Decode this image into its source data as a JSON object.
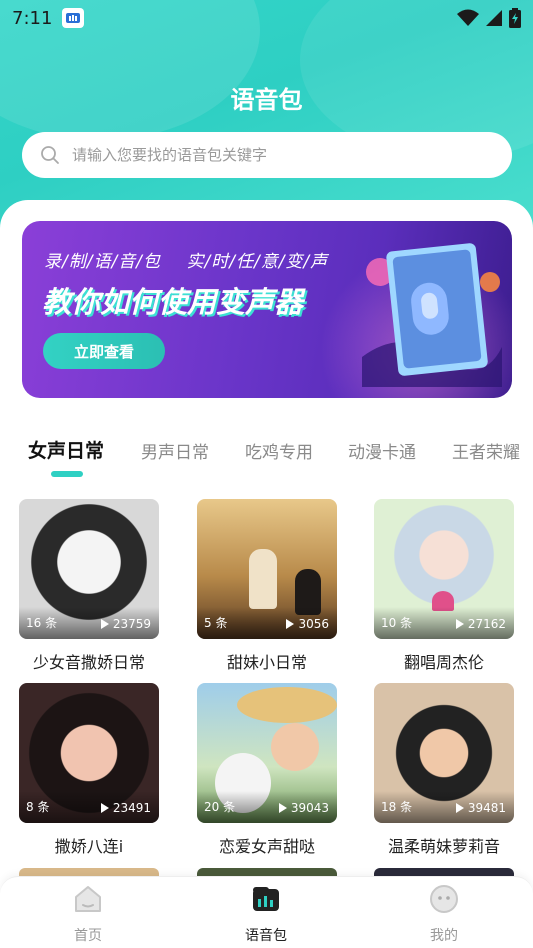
{
  "status_bar": {
    "time": "7:11"
  },
  "header": {
    "title": "语音包",
    "search_placeholder": "请输入您要找的语音包关键字"
  },
  "banner": {
    "subtitle": "录/制/语/音/包    实/时/任/意/变/声",
    "headline": "教你如何使用变声器",
    "button_label": "立即查看"
  },
  "tabs": [
    {
      "label": "女声日常",
      "active": true
    },
    {
      "label": "男声日常",
      "active": false
    },
    {
      "label": "吃鸡专用",
      "active": false
    },
    {
      "label": "动漫卡通",
      "active": false
    },
    {
      "label": "王者荣耀",
      "active": false
    }
  ],
  "cards": [
    {
      "name": "少女音撒娇日常",
      "count": "16 条",
      "plays": "23759",
      "palette": [
        "#e9e9e9",
        "#444444"
      ]
    },
    {
      "name": "甜妹小日常",
      "count": "5 条",
      "plays": "3056",
      "palette": [
        "#c8a46a",
        "#5a3b22"
      ]
    },
    {
      "name": "翻唱周杰伦",
      "count": "10 条",
      "plays": "27162",
      "palette": [
        "#d9ecd0",
        "#6a8aa0"
      ]
    },
    {
      "name": "撒娇八连i",
      "count": "8 条",
      "plays": "23491",
      "palette": [
        "#3a2a2a",
        "#e8b8a8"
      ]
    },
    {
      "name": "恋爱女声甜哒",
      "count": "20 条",
      "plays": "39043",
      "palette": [
        "#8bbfe0",
        "#e8c48a"
      ]
    },
    {
      "name": "温柔萌妹萝莉音",
      "count": "18 条",
      "plays": "39481",
      "palette": [
        "#e0c8b0",
        "#3a3a3a"
      ]
    }
  ],
  "bottom_nav": [
    {
      "label": "首页",
      "icon": "home-icon",
      "active": false
    },
    {
      "label": "语音包",
      "icon": "voice-pack-icon",
      "active": true
    },
    {
      "label": "我的",
      "icon": "profile-icon",
      "active": false
    }
  ],
  "colors": {
    "accent": "#2fd0c3",
    "banner_purple": "#6a35c9"
  }
}
